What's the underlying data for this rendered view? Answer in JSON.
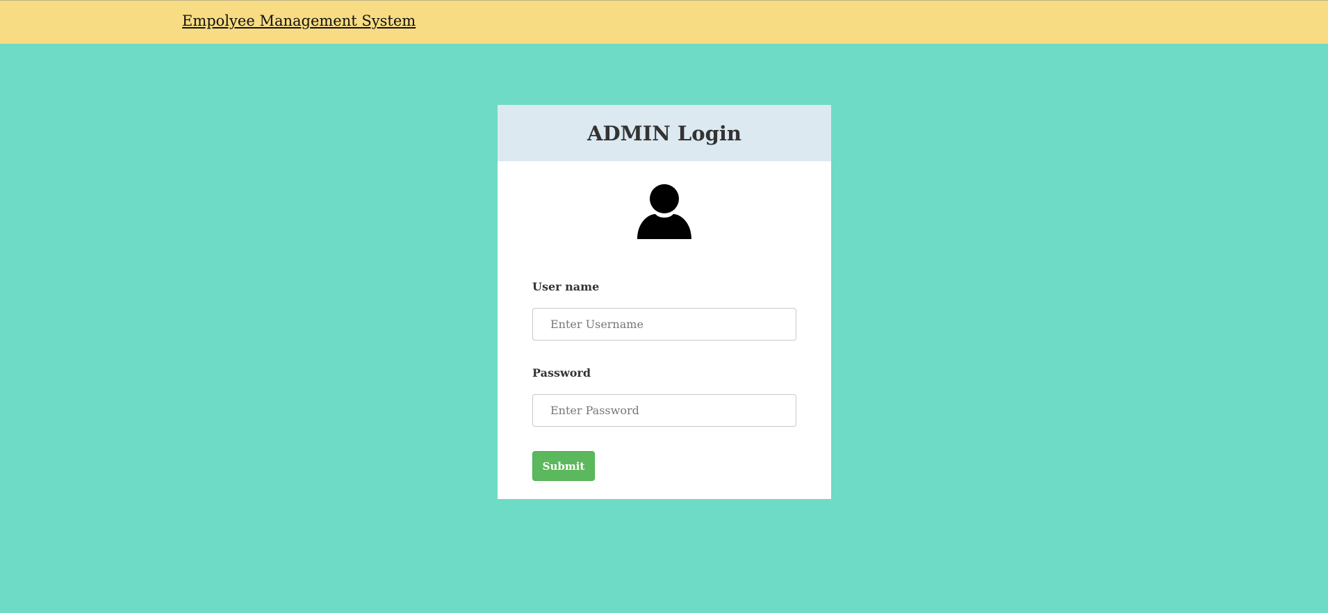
{
  "header": {
    "brand": "Empolyee Management System"
  },
  "login": {
    "title": "ADMIN Login",
    "avatar_icon": "user-icon",
    "username_label": "User name",
    "username_placeholder": "Enter Username",
    "username_value": "",
    "password_label": "Password",
    "password_placeholder": "Enter Password",
    "password_value": "",
    "submit_label": "Submit"
  },
  "colors": {
    "background": "#6edbc6",
    "topbar": "#f7dc83",
    "card_header": "#dde9f1",
    "submit": "#5cb85c"
  }
}
